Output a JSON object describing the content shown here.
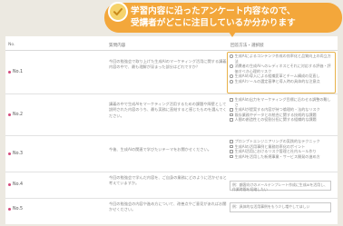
{
  "callout": {
    "line1": "学習内容に沿ったアンケート内容なので、",
    "line2": "受講者がどこに注目しているか分かります"
  },
  "table": {
    "col_no": "No.",
    "col_question": "質問内容",
    "col_options": "回答方法・選択肢",
    "rows": [
      {
        "no": "No.1",
        "question": "今回の勉強会で取り上げた生成AIのマーケティング活用に関する講義内容の中で、最も理解が深まった部分はどれですか？",
        "options": [
          "生成AIによるコンテンツ作成の効率化と品質向上の両立方法",
          "消費者の生成AIへのレディネスとそれに対応する評価・評価すべき心理的リスク",
          "生成AIの導入による組織変革とチーム構成の見直し",
          "生成AIツールの選定基準と導入時の具体的な注意点"
        ]
      },
      {
        "no": "No.2",
        "question": "講義の中で生成AIをマーケティング活用するための課題や障壁として説明された内容のうち、最も実務に直結すると感じたものを選んでください。",
        "options": [
          "生成AIの出力をマーケティング目標に沿わせる調整の難しさ",
          "生成AIが提案する内容が持つ倫理的・法的なリスク",
          "既存業務やデータとの統合に関する技術的な課題",
          "人間の創造性との役割分担に関する組織的な課題"
        ]
      },
      {
        "no": "No.3",
        "question": "今後、生成AIの関連で学びたいテーマをお聞かせください。",
        "options": [
          "プロンプトエンジニアリングの実践的なテクニック",
          "生成AIの活用事例と業務効率化のポイント",
          "生成AI活用におけるリスク管理と社内ルール作り",
          "生成AIを活用した新規事業・サービス開発の進め方"
        ]
      },
      {
        "no": "No.4",
        "question": "今回の勉強会で学んだ内容を、ご自身の業務にどのように活かせると考えていますか。",
        "field": "例：顧客向けのメールテンプレート作成に生成AIを活用し、作業時間を短縮したい"
      },
      {
        "no": "No.5",
        "question": "今回の勉強会の内容や進め方について、改善点やご意見があればお聞かせください。",
        "field": "例：具体的な活用事例をもう少し増やしてほしい"
      }
    ]
  }
}
